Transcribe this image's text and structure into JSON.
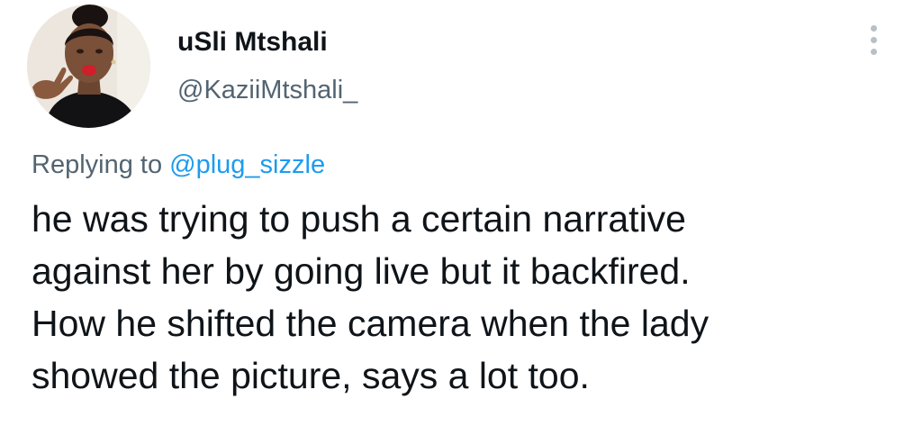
{
  "tweet": {
    "display_name": "uSli Mtshali",
    "handle": "@KaziiMtshali_",
    "replying_prefix": "Replying to ",
    "replying_to": "@plug_sizzle",
    "text_lines": [
      "he was trying to push a certain narrative",
      "against her by going live but it backfired.",
      "How he shifted the camera when the lady",
      "showed the picture, says a lot too."
    ],
    "more_icon": "more-vertical-icon"
  },
  "colors": {
    "text": "#0f1419",
    "secondary": "#536471",
    "link": "#1d9bf0",
    "more_dots": "#b8c0c7"
  }
}
